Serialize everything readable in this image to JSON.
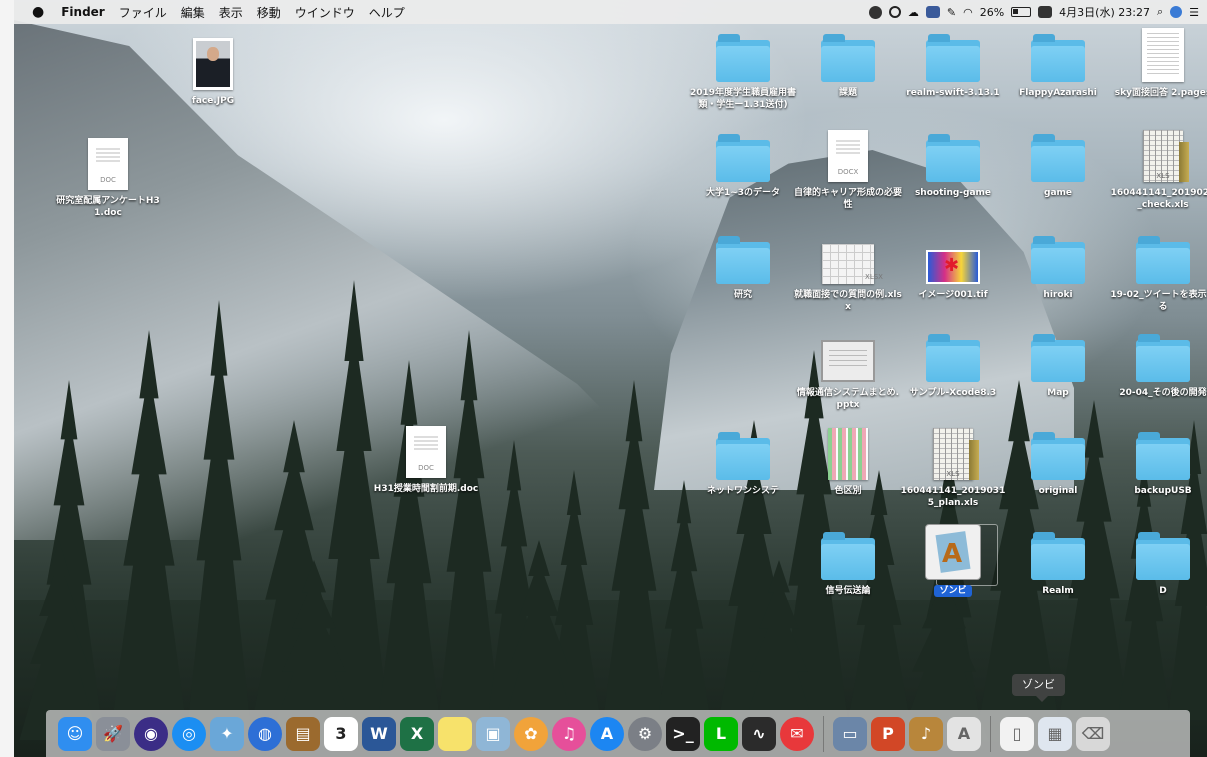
{
  "menubar": {
    "app_name": "Finder",
    "menus": [
      "ファイル",
      "編集",
      "表示",
      "移動",
      "ウインドウ",
      "ヘルプ"
    ],
    "battery": "26%",
    "datetime": "4月3日(水) 23:27"
  },
  "desktop": {
    "icons": [
      {
        "label": "face.JPG",
        "type": "photo",
        "col": 0
      },
      {
        "label": "研究室配属アンケートH31.doc",
        "type": "doc"
      },
      {
        "label": "H31授業時間割前期.doc",
        "type": "doc"
      },
      {
        "label": "2019年度学生職員雇用書類・学生ー1.31送付)",
        "type": "folder"
      },
      {
        "label": "課題",
        "type": "folder"
      },
      {
        "label": "realm-swift-3.13.1",
        "type": "folder"
      },
      {
        "label": "FlappyAzarashi",
        "type": "folder"
      },
      {
        "label": "sky面接回答 2.pages",
        "type": "pages"
      },
      {
        "label": "大学1~3のデータ",
        "type": "folder"
      },
      {
        "label": "自律的キャリア形成の必要性",
        "type": "docx"
      },
      {
        "label": "shooting-game",
        "type": "folder"
      },
      {
        "label": "game",
        "type": "folder"
      },
      {
        "label": "160441141_2019027_check.xls",
        "type": "xls"
      },
      {
        "label": "研究",
        "type": "folder"
      },
      {
        "label": "就職面接での質問の例.xlsx",
        "type": "xlsx"
      },
      {
        "label": "イメージ001.tif",
        "type": "tif"
      },
      {
        "label": "hiroki",
        "type": "folder"
      },
      {
        "label": "19-02_ツイートを表示する",
        "type": "folder"
      },
      {
        "label": "情報通信システムまとめ.pptx",
        "type": "pptx"
      },
      {
        "label": "サンプル-Xcode8.3",
        "type": "folder"
      },
      {
        "label": "Map",
        "type": "folder"
      },
      {
        "label": "20-04_その後の開発",
        "type": "folder"
      },
      {
        "label": "ネットワンシステ",
        "type": "folder"
      },
      {
        "label": "色区別",
        "type": "colorsheet"
      },
      {
        "label": "160441141_20190315_plan.xls",
        "type": "xls"
      },
      {
        "label": "original",
        "type": "folder"
      },
      {
        "label": "backupUSB",
        "type": "folder"
      },
      {
        "label": "信号伝送論",
        "type": "folder"
      },
      {
        "label": "ゾンビ",
        "type": "app",
        "selected": true
      },
      {
        "label": "Realm",
        "type": "folder"
      },
      {
        "label": "D",
        "type": "folder"
      }
    ]
  },
  "dock": {
    "tooltip": "ゾンビ",
    "calendar_day": "3",
    "items": [
      {
        "name": "finder-icon",
        "color": "#2f8ef0"
      },
      {
        "name": "launchpad-icon",
        "color": "#8a8f98"
      },
      {
        "name": "siri-icon",
        "color": "#3b2d86"
      },
      {
        "name": "safari-icon",
        "color": "#1b8ef2"
      },
      {
        "name": "preview-icon",
        "color": "#6aa7d8"
      },
      {
        "name": "globe-icon",
        "color": "#2d6fd6"
      },
      {
        "name": "notebook-icon",
        "color": "#9b6a2e"
      },
      {
        "name": "calendar-icon",
        "color": "#ffffff"
      },
      {
        "name": "word-icon",
        "color": "#2b5797"
      },
      {
        "name": "excel-icon",
        "color": "#1e7145"
      },
      {
        "name": "notes-icon",
        "color": "#f7e26b"
      },
      {
        "name": "image-capture-icon",
        "color": "#8fb6d6"
      },
      {
        "name": "photos-icon",
        "color": "#f1a33a"
      },
      {
        "name": "itunes-icon",
        "color": "#e64f9a"
      },
      {
        "name": "app-store-icon",
        "color": "#1c86f2"
      },
      {
        "name": "system-preferences-icon",
        "color": "#7b7f86"
      },
      {
        "name": "terminal-icon",
        "color": "#222222"
      },
      {
        "name": "line-icon",
        "color": "#00b900"
      },
      {
        "name": "activity-monitor-icon",
        "color": "#2b2b2b"
      },
      {
        "name": "mail-icon",
        "color": "#e8383b"
      },
      {
        "name": "screenshot-icon",
        "color": "#6b86a8"
      },
      {
        "name": "powerpoint-icon",
        "color": "#d24726"
      },
      {
        "name": "guitar-icon",
        "color": "#b8863b"
      },
      {
        "name": "xcode-app-icon",
        "color": "#e3e3e3"
      },
      {
        "name": "document-stack-icon",
        "color": "#f2f2f2"
      },
      {
        "name": "screen-sharing-icon",
        "color": "#dfe6ef"
      },
      {
        "name": "trash-icon",
        "color": "#d8d8d8"
      }
    ]
  }
}
